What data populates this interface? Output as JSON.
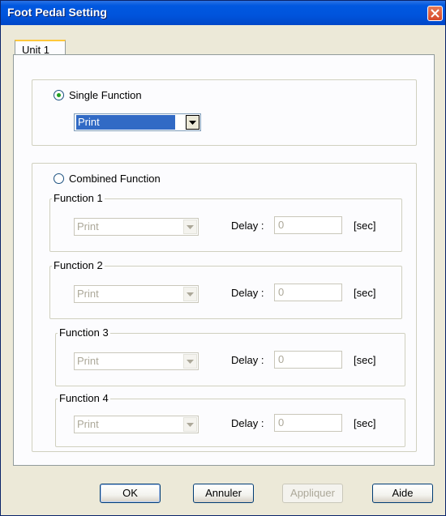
{
  "window": {
    "title": "Foot Pedal Setting"
  },
  "tabs": [
    {
      "label": "Unit 1"
    }
  ],
  "single": {
    "label": "Single Function",
    "selected": true,
    "value": "Print"
  },
  "combined": {
    "label": "Combined Function",
    "selected": false,
    "functions": [
      {
        "label": "Function 1",
        "value": "Print",
        "delay_label": "Delay :",
        "delay": "0",
        "unit": "[sec]"
      },
      {
        "label": "Function 2",
        "value": "Print",
        "delay_label": "Delay :",
        "delay": "0",
        "unit": "[sec]"
      },
      {
        "label": "Function 3",
        "value": "Print",
        "delay_label": "Delay :",
        "delay": "0",
        "unit": "[sec]"
      },
      {
        "label": "Function 4",
        "value": "Print",
        "delay_label": "Delay :",
        "delay": "0",
        "unit": "[sec]"
      }
    ]
  },
  "buttons": {
    "ok": "OK",
    "cancel": "Annuler",
    "apply": "Appliquer",
    "help": "Aide"
  },
  "colors": {
    "titlebar": "#0054DC",
    "face": "#ECE9D8",
    "selection": "#316AC5"
  }
}
